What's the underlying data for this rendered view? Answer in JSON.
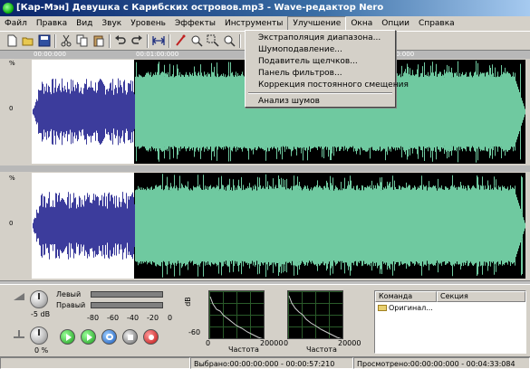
{
  "window": {
    "title": "[Кар-Мэн] Девушка с Карибских островов.mp3 - Wave-редактор Nero"
  },
  "menubar": [
    "Файл",
    "Правка",
    "Вид",
    "Звук",
    "Уровень",
    "Эффекты",
    "Инструменты",
    "Улучшение",
    "Окна",
    "Опции",
    "Справка"
  ],
  "enhance_menu": {
    "items": [
      "Экстраполяция диапазона...",
      "Шумоподавление...",
      "Подавитель щелчков...",
      "Панель фильтров...",
      "Коррекция постоянного смещения"
    ],
    "extra_item": "Анализ шумов"
  },
  "ruler": {
    "labels": [
      "00:00:000",
      "00:01:00:000",
      "00:02:00:000"
    ]
  },
  "y_axis": {
    "top": "0",
    "bottom": "0"
  },
  "waveform": {
    "selection_fraction": 0.21,
    "selected_color": "#3c3c9c",
    "unselected_color": "#6fc9a0"
  },
  "controls": {
    "volume": "-5 dB",
    "pan": "0 %",
    "left_label": "Левый",
    "right_label": "Правый",
    "meter_scale": [
      "-80",
      "-60",
      "-40",
      "-20",
      "0"
    ]
  },
  "spectrum": {
    "db_label": "dB",
    "y_min": "-60",
    "x_min": "0",
    "x_max": "20000",
    "x_label": "Частота"
  },
  "history": {
    "col_command": "Команда",
    "col_section": "Секция",
    "rows": [
      "Оригинал..."
    ]
  },
  "status": {
    "selected": "Выбрано:00:00:00:000 - 00:00:57:210",
    "viewed": "Просмотрено:00:00:00:000 - 00:04:33:084"
  }
}
